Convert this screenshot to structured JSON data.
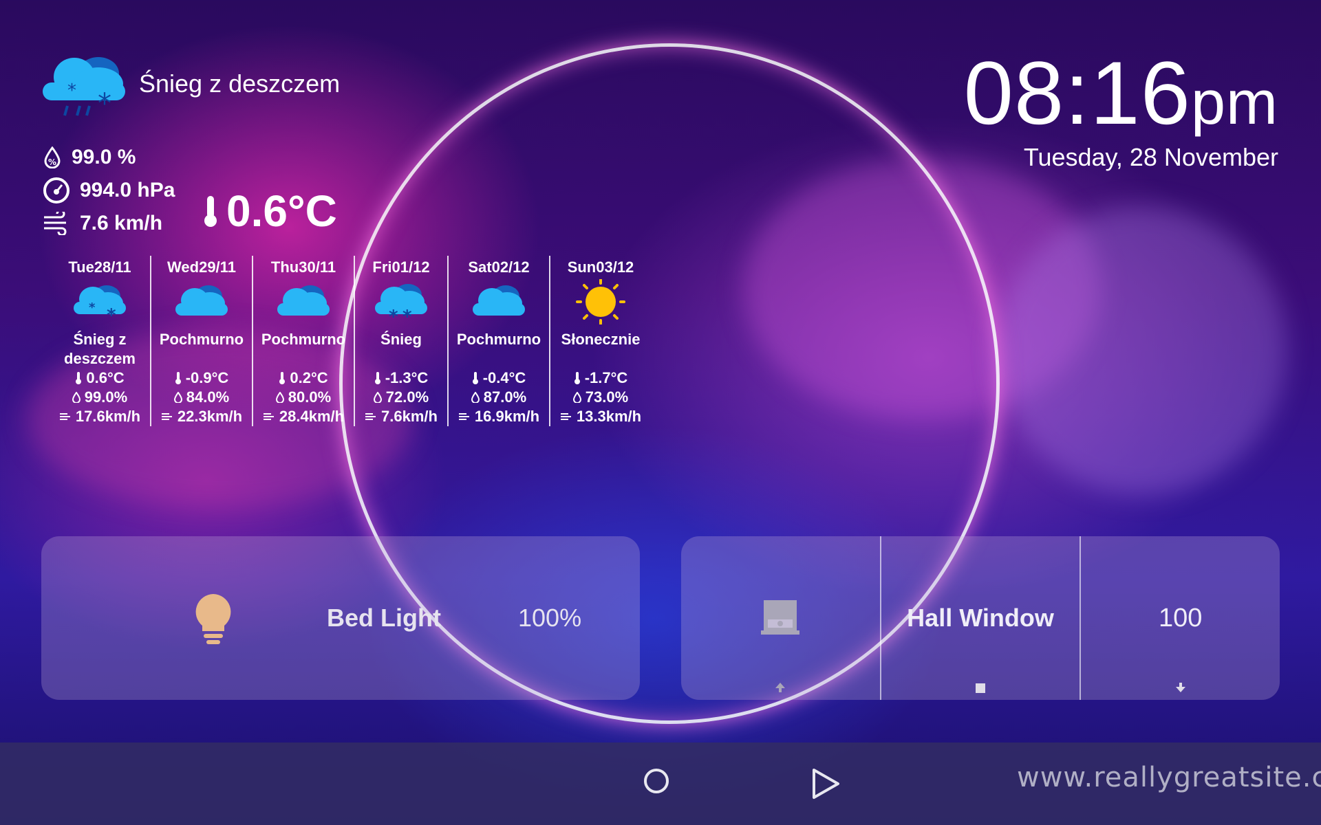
{
  "current": {
    "condition": "Śnieg z deszczem",
    "humidity": "99.0 %",
    "pressure": "994.0 hPa",
    "wind": "7.6 km/h",
    "temperature": "0.6°C",
    "icon": "snow-rain-cloud-icon"
  },
  "clock": {
    "time": "08:16",
    "ampm": "pm",
    "date": "Tuesday, 28 November"
  },
  "forecast": [
    {
      "day": "Tue28/11",
      "icon": "snow-cloud-icon",
      "condition": "Śnieg z deszczem",
      "temp": "0.6°C",
      "humidity": "99.0%",
      "wind": "17.6km/h"
    },
    {
      "day": "Wed29/11",
      "icon": "cloud-icon",
      "condition": "Pochmurno",
      "temp": "-0.9°C",
      "humidity": "84.0%",
      "wind": "22.3km/h"
    },
    {
      "day": "Thu30/11",
      "icon": "cloud-icon",
      "condition": "Pochmurno",
      "temp": "0.2°C",
      "humidity": "80.0%",
      "wind": "28.4km/h"
    },
    {
      "day": "Fri01/12",
      "icon": "snow-icon",
      "condition": "Śnieg",
      "temp": "-1.3°C",
      "humidity": "72.0%",
      "wind": "7.6km/h"
    },
    {
      "day": "Sat02/12",
      "icon": "cloud-icon",
      "condition": "Pochmurno",
      "temp": "-0.4°C",
      "humidity": "87.0%",
      "wind": "16.9km/h"
    },
    {
      "day": "Sun03/12",
      "icon": "sun-icon",
      "condition": "Słonecznie",
      "temp": "-1.7°C",
      "humidity": "73.0%",
      "wind": "13.3km/h"
    }
  ],
  "bed_light": {
    "label": "Bed Light",
    "value": "100%",
    "icon": "light-bulb-icon"
  },
  "hall_window": {
    "label": "Hall Window",
    "value": "100",
    "icon": "window-shade-icon"
  },
  "navbar": {
    "site": "www.reallygreatsite.com"
  },
  "colors": {
    "cloud": "#29b6f6",
    "sun": "#ffc107",
    "bulb": "#e8b98a"
  }
}
